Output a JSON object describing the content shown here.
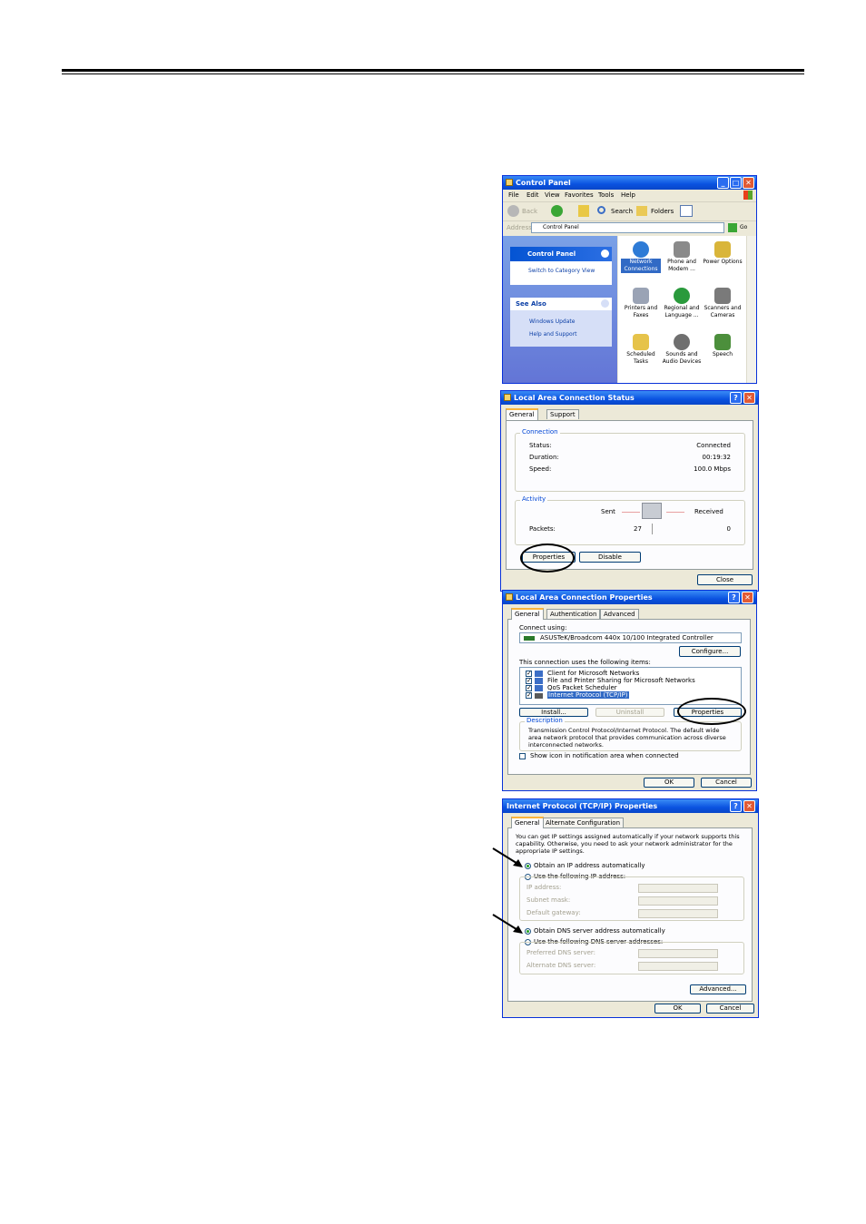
{
  "control_panel": {
    "title": "Control Panel",
    "menu": [
      "File",
      "Edit",
      "View",
      "Favorites",
      "Tools",
      "Help"
    ],
    "toolbar": {
      "back": "Back",
      "search": "Search",
      "folders": "Folders"
    },
    "address_label": "Address",
    "address_value": "Control Panel",
    "go": "Go",
    "side_title": "Control Panel",
    "switch_view": "Switch to Category View",
    "see_also": "See Also",
    "windows_update": "Windows Update",
    "help_support": "Help and Support",
    "items": [
      {
        "line1": "Network",
        "line2": "Connections",
        "icon": "globe-network-icon",
        "color": "#2e7bd6"
      },
      {
        "line1": "Phone and",
        "line2": "Modem ...",
        "icon": "phone-icon",
        "color": "#8a8a8a"
      },
      {
        "line1": "Power Options",
        "line2": "",
        "icon": "power-icon",
        "color": "#d9b53a"
      },
      {
        "line1": "Printers and",
        "line2": "Faxes",
        "icon": "printer-icon",
        "color": "#9aa3b5"
      },
      {
        "line1": "Regional and",
        "line2": "Language ...",
        "icon": "globe-icon",
        "color": "#2a9a3c"
      },
      {
        "line1": "Scanners and",
        "line2": "Cameras",
        "icon": "camera-icon",
        "color": "#7a7a7a"
      },
      {
        "line1": "Scheduled",
        "line2": "Tasks",
        "icon": "folder-clock-icon",
        "color": "#e6c34a"
      },
      {
        "line1": "Sounds and",
        "line2": "Audio Devices",
        "icon": "speaker-icon",
        "color": "#6f6f6f"
      },
      {
        "line1": "Speech",
        "line2": "",
        "icon": "speech-icon",
        "color": "#4c8f3c"
      }
    ]
  },
  "status_dialog": {
    "title": "Local Area Connection Status",
    "tabs": [
      "General",
      "Support"
    ],
    "connection_group": "Connection",
    "status_label": "Status:",
    "status_value": "Connected",
    "duration_label": "Duration:",
    "duration_value": "00:19:32",
    "speed_label": "Speed:",
    "speed_value": "100.0 Mbps",
    "activity_group": "Activity",
    "sent": "Sent",
    "received": "Received",
    "packets_label": "Packets:",
    "packets_sent": "27",
    "packets_received": "0",
    "properties_btn": "Properties",
    "disable_btn": "Disable",
    "close_btn": "Close"
  },
  "props_dialog": {
    "title": "Local Area Connection Properties",
    "tabs": [
      "General",
      "Authentication",
      "Advanced"
    ],
    "connect_using": "Connect using:",
    "adapter": "ASUSTeK/Broadcom 440x 10/100 Integrated Controller",
    "configure_btn": "Configure...",
    "uses_items": "This connection uses the following items:",
    "items": [
      "Client for Microsoft Networks",
      "File and Printer Sharing for Microsoft Networks",
      "QoS Packet Scheduler",
      "Internet Protocol (TCP/IP)"
    ],
    "install_btn": "Install...",
    "uninstall_btn": "Uninstall",
    "properties_btn": "Properties",
    "description_group": "Description",
    "description": "Transmission Control Protocol/Internet Protocol. The default wide area network protocol that provides communication across diverse interconnected networks.",
    "show_icon": "Show icon in notification area when connected",
    "ok_btn": "OK",
    "cancel_btn": "Cancel"
  },
  "tcpip_dialog": {
    "title": "Internet Protocol (TCP/IP) Properties",
    "tabs": [
      "General",
      "Alternate Configuration"
    ],
    "intro": "You can get IP settings assigned automatically if your network supports this capability. Otherwise, you need to ask your network administrator for the appropriate IP settings.",
    "obtain_ip": "Obtain an IP address automatically",
    "use_ip": "Use the following IP address:",
    "ip_address": "IP address:",
    "subnet_mask": "Subnet mask:",
    "default_gateway": "Default gateway:",
    "obtain_dns": "Obtain DNS server address automatically",
    "use_dns": "Use the following DNS server addresses:",
    "preferred_dns": "Preferred DNS server:",
    "alternate_dns": "Alternate DNS server:",
    "advanced_btn": "Advanced...",
    "ok_btn": "OK",
    "cancel_btn": "Cancel"
  }
}
